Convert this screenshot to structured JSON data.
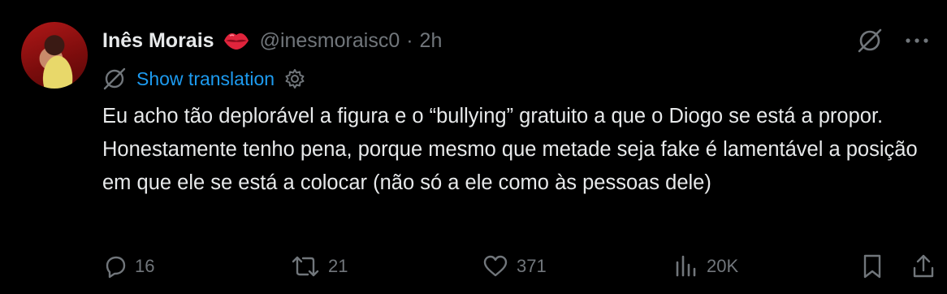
{
  "author": {
    "name": "Inês Morais",
    "handle": "@inesmoraisc0",
    "separator": "·",
    "time": "2h",
    "emoji": "kiss-mark-lips",
    "avatar": "profile-photo"
  },
  "translation": {
    "link_label": "Show translation"
  },
  "tweet": {
    "text": "Eu acho tão deplorável a figura e o “bullying” gratuito a que o Diogo se está a propor. Honestamente tenho pena, porque mesmo que metade seja fake é lamentável a posição em que ele se está a colocar (não só a ele como às pessoas dele)"
  },
  "actions": {
    "replies": "16",
    "reposts": "21",
    "likes": "371",
    "views": "20K"
  },
  "colors": {
    "background": "#000000",
    "text": "#e7e9ea",
    "secondary": "#71767b",
    "link": "#1d9bf0"
  },
  "icons": [
    "grok-icon",
    "more-icon",
    "translate-icon",
    "settings-gear-icon",
    "reply-icon",
    "repost-icon",
    "like-icon",
    "views-icon",
    "bookmark-icon",
    "share-icon"
  ]
}
